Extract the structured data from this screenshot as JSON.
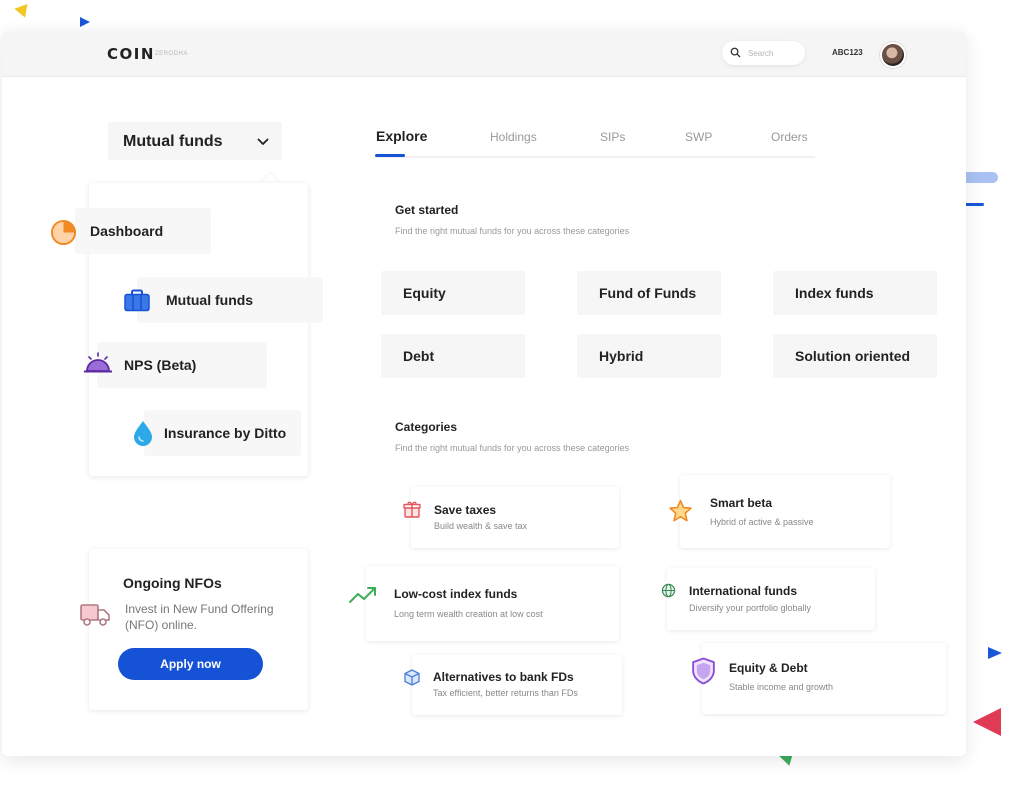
{
  "header": {
    "logo": "COIN",
    "logo_sub": "ZERODHA",
    "search_placeholder": "Search",
    "user_id": "ABC123"
  },
  "product_selector": {
    "selected": "Mutual funds"
  },
  "menu": {
    "items": [
      {
        "label": "Dashboard",
        "icon": "pie-chart-icon"
      },
      {
        "label": "Mutual funds",
        "icon": "briefcase-icon"
      },
      {
        "label": "NPS (Beta)",
        "icon": "sunset-icon"
      },
      {
        "label": "Insurance by Ditto",
        "icon": "droplet-icon"
      }
    ]
  },
  "nfo": {
    "title": "Ongoing NFOs",
    "description": "Invest in New Fund Offering (NFO) online.",
    "button": "Apply now",
    "icon": "truck-icon"
  },
  "tabs": [
    {
      "label": "Explore",
      "active": true
    },
    {
      "label": "Holdings",
      "active": false
    },
    {
      "label": "SIPs",
      "active": false
    },
    {
      "label": "SWP",
      "active": false
    },
    {
      "label": "Orders",
      "active": false
    }
  ],
  "get_started": {
    "title": "Get started",
    "subtitle": "Find the right mutual funds for you across these categories",
    "tiles": [
      "Equity",
      "Fund of Funds",
      "Index funds",
      "Debt",
      "Hybrid",
      "Solution oriented"
    ]
  },
  "categories": {
    "title": "Categories",
    "subtitle": "Find the right mutual funds for you across these categories",
    "cards": [
      {
        "title": "Save taxes",
        "subtitle": "Build wealth & save tax",
        "icon": "gift-icon"
      },
      {
        "title": "Smart beta",
        "subtitle": "Hybrid of active & passive",
        "icon": "star-icon"
      },
      {
        "title": "Low-cost index funds",
        "subtitle": "Long term wealth creation at low cost",
        "icon": "trending-up-icon"
      },
      {
        "title": "International funds",
        "subtitle": "Diversify your portfolio globally",
        "icon": "globe-icon"
      },
      {
        "title": "Alternatives to bank FDs",
        "subtitle": "Tax efficient, better returns than FDs",
        "icon": "cube-icon"
      },
      {
        "title": "Equity & Debt",
        "subtitle": "Stable income and growth",
        "icon": "shield-icon"
      }
    ]
  },
  "colors": {
    "accent": "#1552d6",
    "tile_bg": "#f6f6f6"
  }
}
